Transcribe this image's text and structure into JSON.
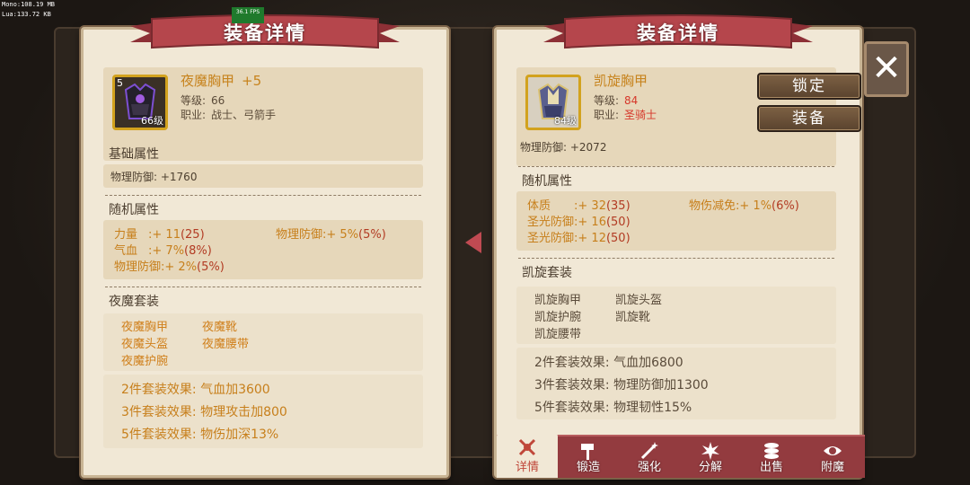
{
  "debug": {
    "mono": "Mono:108.19 MB",
    "lua": "Lua:133.72 KB",
    "fps": "36.1 FPS"
  },
  "left": {
    "title": "装备详情",
    "item": {
      "name": "夜魔胸甲",
      "plus": "+5",
      "corner": "5",
      "level_badge": "66级",
      "level_label": "等级:",
      "level": "66",
      "class_label": "职业:",
      "class": "战士、弓箭手"
    },
    "base_title": "基础属性",
    "base_line": "物理防御: +1760",
    "random_title": "随机属性",
    "attrs": [
      {
        "k": "力量",
        "v": ":+ 11",
        "r": "(25)"
      },
      {
        "k": "气血",
        "v": ":+ 7%",
        "r": "(8%)"
      },
      {
        "k": "物理防御",
        "v": ":+ 2%",
        "r": "(5%)"
      },
      {
        "k": "物理防御",
        "v": ":+ 5%",
        "r": "(5%)"
      }
    ],
    "set_title": "夜魔套装",
    "set_items": [
      "夜魔胸甲",
      "夜魔靴",
      "夜魔头盔",
      "夜魔腰带",
      "夜魔护腕"
    ],
    "effects": [
      "2件套装效果:  气血加3600",
      "3件套装效果:  物理攻击加800",
      "5件套装效果:  物伤加深13%"
    ]
  },
  "right": {
    "title": "装备详情",
    "item": {
      "name": "凯旋胸甲",
      "level_badge": "84级",
      "level_label": "等级:",
      "level": "84",
      "class_label": "职业:",
      "class": "圣骑士"
    },
    "buttons": {
      "lock": "锁定",
      "equip": "装备"
    },
    "base_line": "物理防御: +2072",
    "random_title": "随机属性",
    "attrs": [
      {
        "k": "体质",
        "v": ":+ 32",
        "r": "(35)"
      },
      {
        "k": "圣光防御",
        "v": ":+ 16",
        "r": "(50)"
      },
      {
        "k": "圣光防御",
        "v": ":+ 12",
        "r": "(50)"
      },
      {
        "k": "物伤减免",
        "v": ":+ 1%",
        "r": "(6%)"
      }
    ],
    "set_title": "凯旋套装",
    "set_items": [
      "凯旋胸甲",
      "凯旋头盔",
      "凯旋护腕",
      "凯旋靴",
      "凯旋腰带"
    ],
    "effects": [
      "2件套装效果:  气血加6800",
      "3件套装效果:  物理防御加1300",
      "5件套装效果:  物理韧性15%"
    ],
    "tabs": [
      "详情",
      "锻造",
      "强化",
      "分解",
      "出售",
      "附魔"
    ]
  },
  "close_label": "✕",
  "colors": {
    "ribbon": "#b5464c",
    "tabbar": "#933b3f",
    "gold": "#d2a21e",
    "orange": "#c77f1b"
  }
}
